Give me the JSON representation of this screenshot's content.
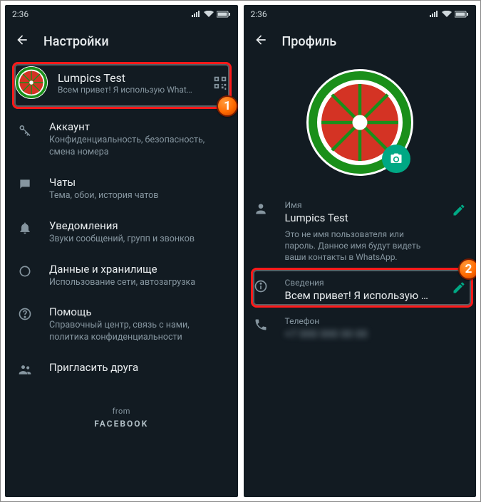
{
  "status": {
    "time": "2:36"
  },
  "left": {
    "title": "Настройки",
    "profile": {
      "name": "Lumpics Test",
      "status": "Всем привет! Я использую What…"
    },
    "items": {
      "account": {
        "title": "Аккаунт",
        "sub": "Конфиденциальность, безопасность, смена номера"
      },
      "chats": {
        "title": "Чаты",
        "sub": "Тема, обои, история чатов"
      },
      "notif": {
        "title": "Уведомления",
        "sub": "Звуки сообщений, групп и звонков"
      },
      "data": {
        "title": "Данные и хранилище",
        "sub": "Использование сети, автозагрузка"
      },
      "help": {
        "title": "Помощь",
        "sub": "Справочный центр, связь с нами, политика конфиденциальности"
      },
      "invite": {
        "title": "Пригласить друга"
      }
    },
    "footer": {
      "from": "from",
      "brand": "FACEBOOK"
    }
  },
  "right": {
    "title": "Профиль",
    "name": {
      "label": "Имя",
      "value": "Lumpics Test",
      "hint": "Это не имя пользователя или пароль. Данное имя будут видеть ваши контакты в WhatsApp."
    },
    "about": {
      "label": "Сведения",
      "value": "Всем привет! Я использую WhatsA…"
    },
    "phone": {
      "label": "Телефон",
      "value": "+7 000 000 00 00"
    }
  },
  "badges": {
    "one": "1",
    "two": "2"
  }
}
